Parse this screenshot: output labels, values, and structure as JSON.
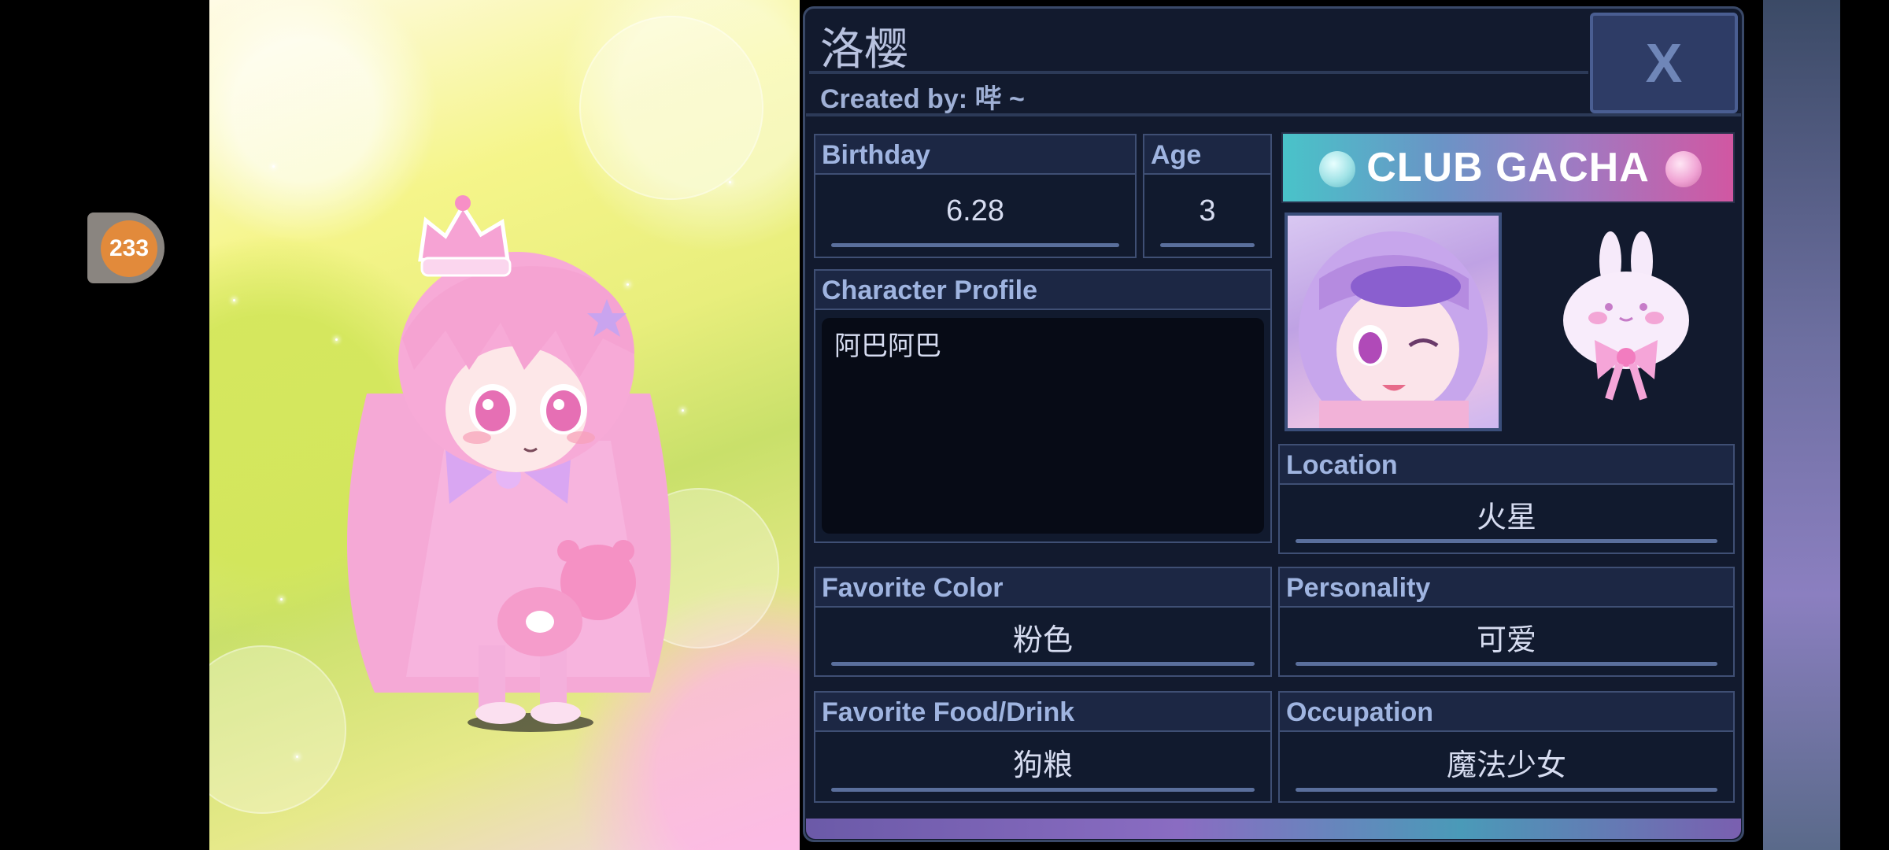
{
  "badge": {
    "count": "233"
  },
  "character": {
    "name": "洛樱",
    "created_by": "Created by: 哔 ~"
  },
  "close": {
    "label": "X"
  },
  "fields": {
    "birthday": {
      "label": "Birthday",
      "value": "6.28"
    },
    "age": {
      "label": "Age",
      "value": "3"
    },
    "profile": {
      "label": "Character Profile",
      "value": "阿巴阿巴"
    },
    "location": {
      "label": "Location",
      "value": "火星"
    },
    "favorite_color": {
      "label": "Favorite Color",
      "value": "粉色"
    },
    "personality": {
      "label": "Personality",
      "value": "可爱"
    },
    "favorite_food": {
      "label": "Favorite Food/Drink",
      "value": "狗粮"
    },
    "occupation": {
      "label": "Occupation",
      "value": "魔法少女"
    }
  },
  "logo": {
    "text": "CLUB GACHA"
  },
  "colors": {
    "panel_bg": "#121a2e",
    "label_text": "#9fb4e0",
    "value_text": "#d6dcf0",
    "badge": "#e28a3b"
  }
}
